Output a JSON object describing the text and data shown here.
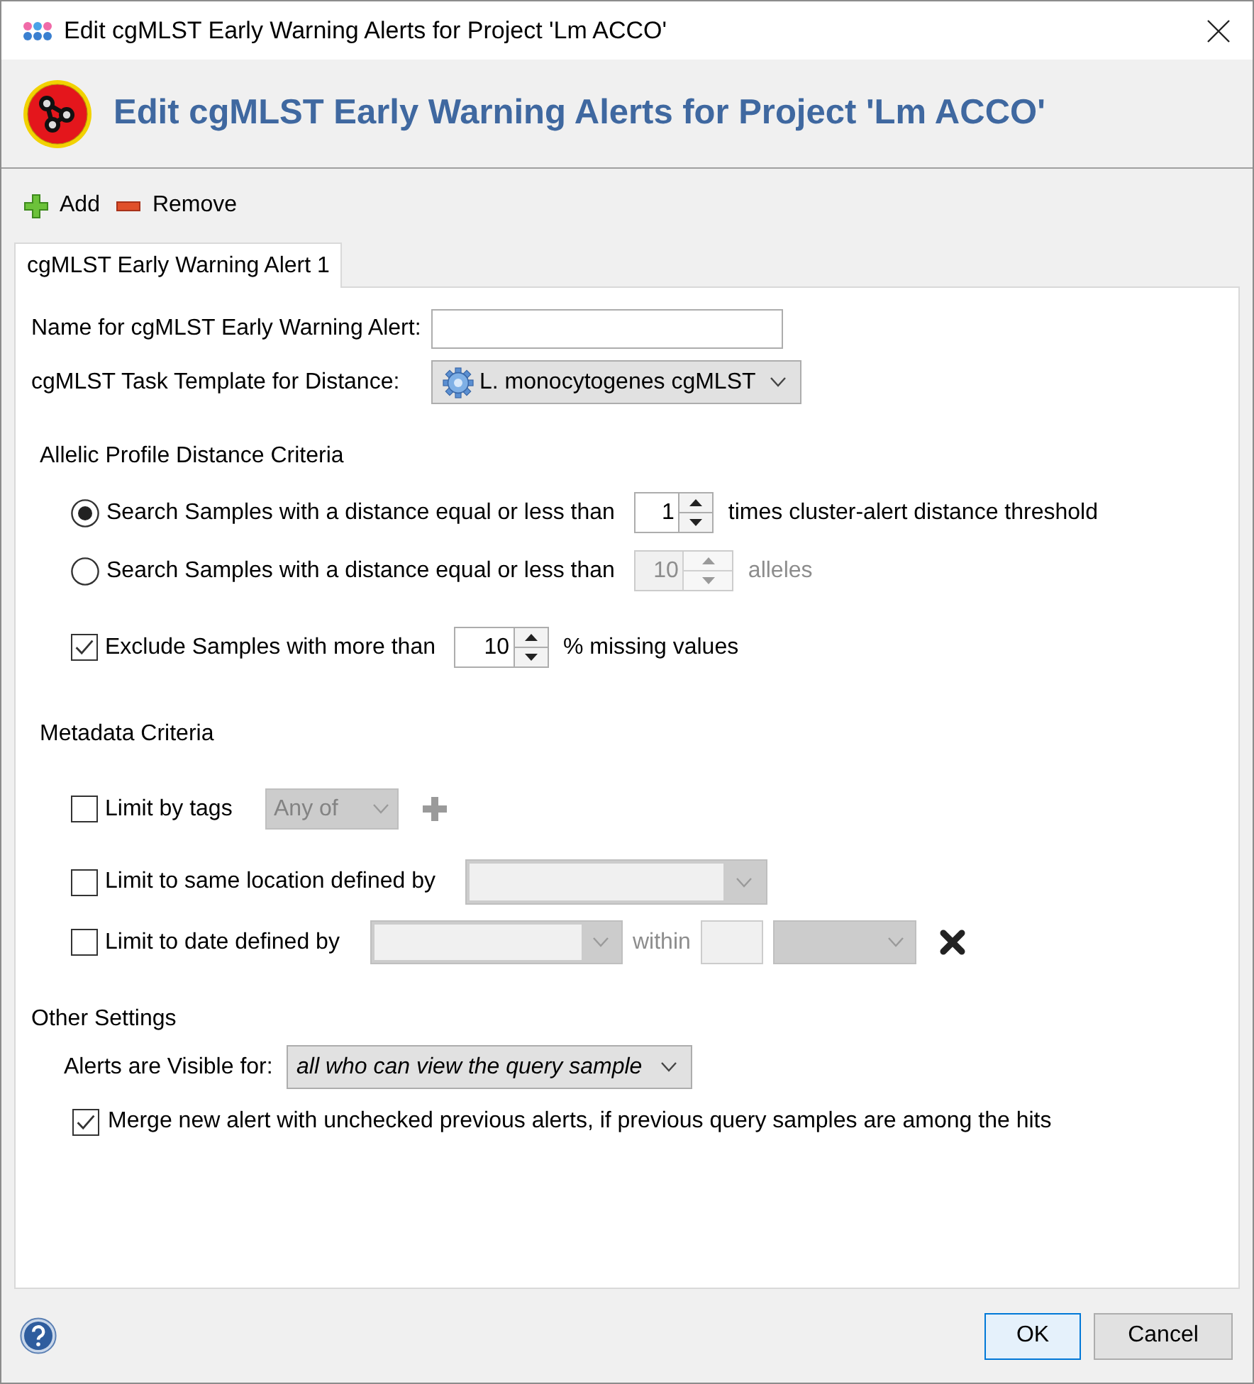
{
  "window": {
    "title": "Edit cgMLST Early Warning Alerts for Project 'Lm ACCO'"
  },
  "header": {
    "title": "Edit cgMLST Early Warning Alerts for Project 'Lm ACCO'"
  },
  "toolbar": [
    {
      "kind": "add",
      "label": "Add"
    },
    {
      "kind": "remove",
      "label": "Remove"
    }
  ],
  "tabs": [
    {
      "label": "cgMLST Early Warning Alert 1",
      "selected": true
    }
  ],
  "general": {
    "name": {
      "label": "Name for cgMLST Early Warning Alert:"
    },
    "template": {
      "label": "cgMLST Task Template for Distance:",
      "value": "L. monocytogenes cgMLST"
    }
  },
  "distance_criteria": {
    "title": "Allelic Profile Distance Criteria",
    "options": [
      {
        "label": "Search Samples with a distance equal or less than",
        "value": "1",
        "unit": "times cluster-alert distance threshold",
        "selected": true
      },
      {
        "label": "Search Samples with a distance equal or less than",
        "value": "10",
        "unit": "alleles",
        "selected": false
      }
    ],
    "exclude": {
      "label": "Exclude Samples with more than",
      "value": "10",
      "unit": "% missing values",
      "checked": true
    }
  },
  "metadata_criteria": {
    "title": "Metadata Criteria",
    "rows": [
      {
        "kind": "tags",
        "label": "Limit by tags",
        "checked": false,
        "value": "Any of"
      },
      {
        "kind": "location",
        "label": "Limit to same location defined by",
        "checked": false
      },
      {
        "kind": "date",
        "label": "Limit to date defined by",
        "checked": false,
        "within": "within"
      }
    ]
  },
  "other_settings": {
    "title": "Other Settings",
    "visibility": {
      "label": "Alerts are Visible for:",
      "value": "all who can view the query sample"
    },
    "merge": {
      "label": "Merge new alert with unchecked previous alerts, if previous query samples are among the hits",
      "checked": true
    }
  },
  "buttons": [
    {
      "kind": "primary",
      "label": "OK"
    },
    {
      "kind": "secondary",
      "label": "Cancel"
    }
  ]
}
